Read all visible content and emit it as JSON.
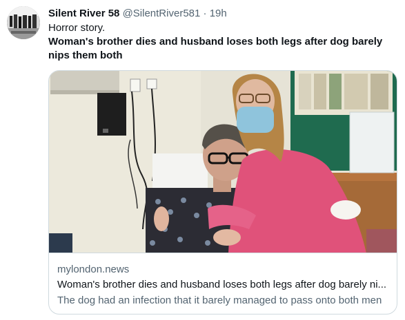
{
  "tweet": {
    "display_name": "Silent River 58",
    "handle": "@SilentRiver581",
    "separator": "·",
    "time": "19h",
    "text_line": "Horror story.",
    "text_bold": "Woman's brother dies and husband loses both legs after dog barely nips them both"
  },
  "link_card": {
    "domain": "mylondon.news",
    "title": "Woman's brother dies and husband loses both legs after dog barely ni...",
    "description": "The dog had an infection that it barely managed to pass onto both men",
    "image_alt": "Photo of a woman in a pink top hugging a man in a patterned shirt in a hospital room"
  },
  "colors": {
    "text_primary": "#0f1419",
    "text_secondary": "#536471",
    "border": "#cfd9de",
    "pink_top": "#e0527a"
  }
}
